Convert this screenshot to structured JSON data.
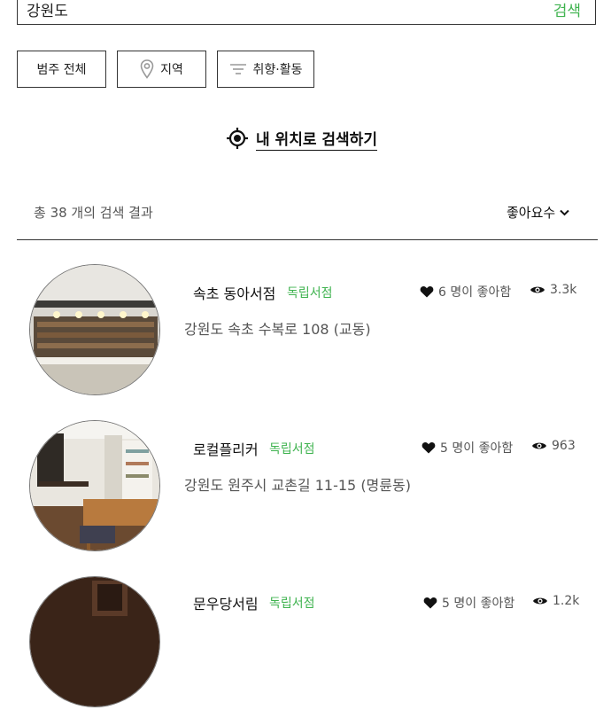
{
  "search": {
    "value": "강원도",
    "button_label": "검색"
  },
  "filters": [
    {
      "label": "범주 전체",
      "icon": "none"
    },
    {
      "label": "지역",
      "icon": "map-pin-icon"
    },
    {
      "label": "취향·활동",
      "icon": "filter-lines-icon"
    }
  ],
  "locate": {
    "label": "내 위치로 검색하기",
    "icon": "crosshair-location-icon"
  },
  "results": {
    "summary": "총 38 개의 검색 결과",
    "sort_label": "좋아요수"
  },
  "colors": {
    "accent": "#3fb34f",
    "text": "#222222",
    "muted": "#555555"
  },
  "stores": [
    {
      "name": "속초 동아서점",
      "tag": "독립서점",
      "likes": "6 명이 좋아함",
      "views": "3.3k",
      "address": "강원도 속초 수복로 108 (교동)"
    },
    {
      "name": "로컬플리커",
      "tag": "독립서점",
      "likes": "5 명이 좋아함",
      "views": "963",
      "address": "강원도 원주시 교촌길 11-15 (명륜동)"
    },
    {
      "name": "문우당서림",
      "tag": "독립서점",
      "likes": "5 명이 좋아함",
      "views": "1.2k",
      "address": ""
    }
  ]
}
